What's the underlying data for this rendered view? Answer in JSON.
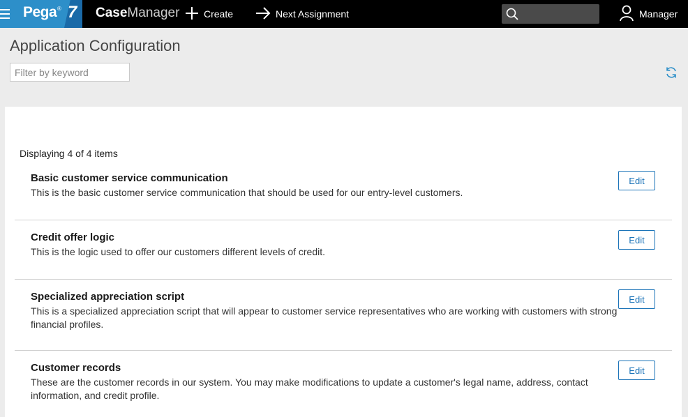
{
  "topbar": {
    "brand": "Pega",
    "brand_mark": "®",
    "brand_version": "7",
    "app_name_bold": "Case",
    "app_name_light": "Manager",
    "create_label": "Create",
    "next_assignment_label": "Next Assignment",
    "search_placeholder": "",
    "user_label": "Manager",
    "colors": {
      "bar": "#000000",
      "brand_blue": "#2d8fc9",
      "brand_dark": "#1a6aa8"
    }
  },
  "page": {
    "title": "Application Configuration",
    "filter_placeholder": "Filter by keyword",
    "refresh_icon": "refresh-icon"
  },
  "list": {
    "count_text": "Displaying 4 of 4 items",
    "items": [
      {
        "title": "Basic customer service communication",
        "description": "This is the basic customer service communication that should be used for our entry-level customers.",
        "action": "Edit"
      },
      {
        "title": "Credit offer logic",
        "description": "This is the logic used to offer our customers different levels of credit.",
        "action": "Edit"
      },
      {
        "title": "Specialized appreciation script",
        "description": "This is a specialized appreciation script that will appear to customer service representatives who are working with customers with strong financial profiles.",
        "action": "Edit"
      },
      {
        "title": "Customer records",
        "description": "These are the customer records in our system. You may make modifications to update a customer's legal name, address, contact information, and credit profile.",
        "action": "Edit"
      }
    ]
  },
  "accent_color": "#1a73b8"
}
